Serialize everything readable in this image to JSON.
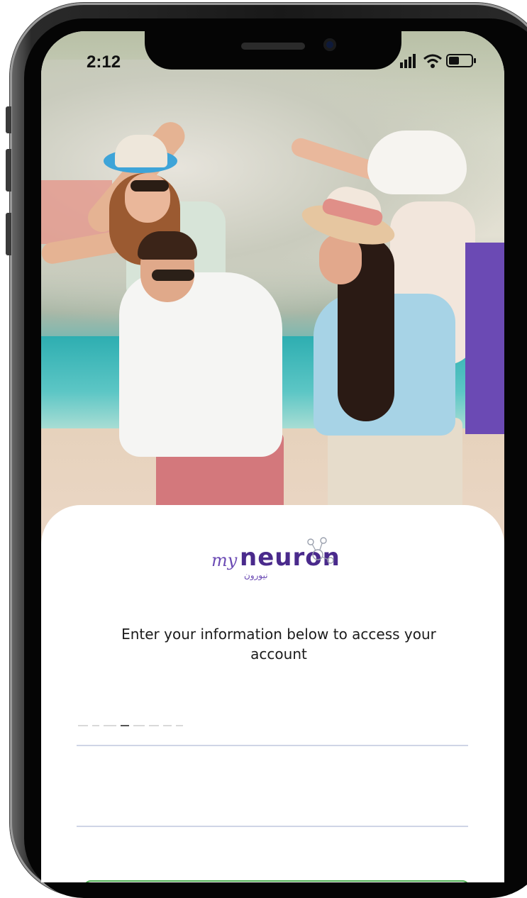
{
  "status_bar": {
    "time": "2:12",
    "icons": [
      "signal-icon",
      "wifi-icon",
      "battery-icon"
    ]
  },
  "brand": {
    "name": "myneuron",
    "prefix": "my",
    "wordmark": "neuron",
    "arabic": "نيورون"
  },
  "login": {
    "instruction": "Enter your information below to access your account",
    "fields": [
      {
        "placeholder": ""
      },
      {
        "placeholder": ""
      }
    ],
    "button_label": ""
  },
  "colors": {
    "brand_purple": "#4a2a8c",
    "accent_green": "#4caf50",
    "pink_block": "#e49b8f",
    "purple_block": "#6b4ab4"
  }
}
